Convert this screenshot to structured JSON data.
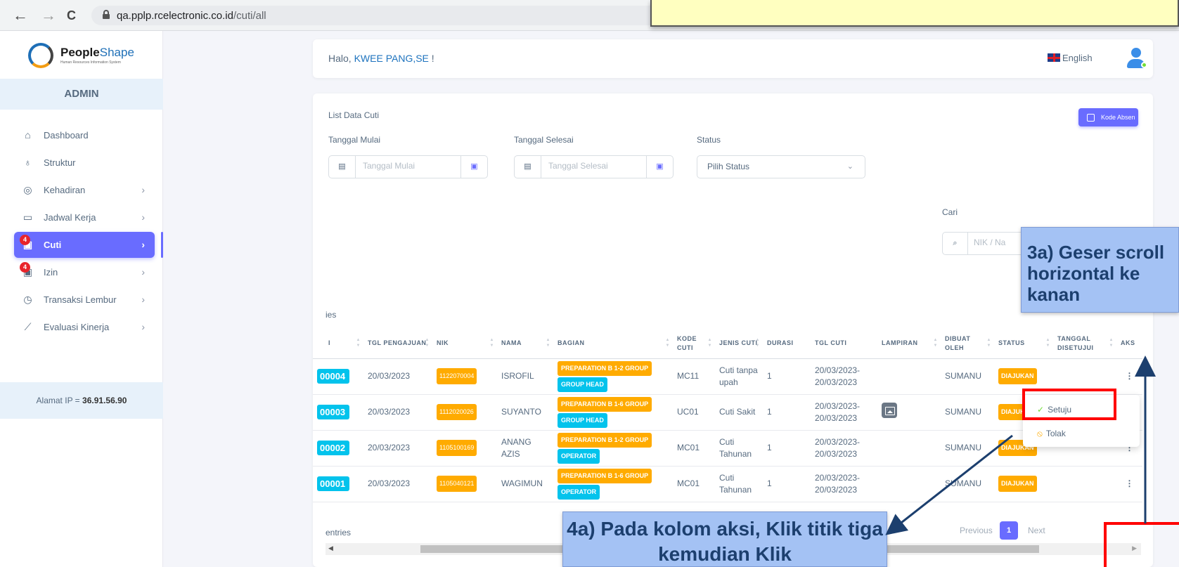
{
  "browser": {
    "back": "←",
    "forward": "→",
    "reload": "C",
    "url_domain": "qa.pplp.rcelectronic.co.id",
    "url_path": "/cuti/all"
  },
  "sidebar": {
    "logo_name_a": "People",
    "logo_name_b": "Shape",
    "logo_tagline": "Human Resources Information System",
    "role": "ADMIN",
    "items": [
      {
        "label": "Dashboard",
        "icon": "home-icon"
      },
      {
        "label": "Struktur",
        "icon": "hierarchy-icon"
      },
      {
        "label": "Kehadiran",
        "icon": "fingerprint-icon"
      },
      {
        "label": "Jadwal Kerja",
        "icon": "briefcase-icon"
      },
      {
        "label": "Cuti",
        "icon": "calendar-icon",
        "badge": "4"
      },
      {
        "label": "Izin",
        "icon": "calendar-icon",
        "badge": "4"
      },
      {
        "label": "Transaksi Lembur",
        "icon": "clock-icon"
      },
      {
        "label": "Evaluasi Kinerja",
        "icon": "chart-line-icon"
      }
    ],
    "ip_label": "Alamat IP  =",
    "ip_value": "36.91.56.90"
  },
  "header": {
    "greeting_prefix": "Halo, ",
    "user": "KWEE PANG,SE",
    "greeting_suffix": " !",
    "language": "English"
  },
  "card": {
    "title": "List Data Cuti",
    "kode_absen": "Kode Absen",
    "tanggal_mulai_label": "Tanggal Mulai",
    "tanggal_mulai_placeholder": "Tanggal Mulai",
    "tanggal_selesai_label": "Tanggal Selesai",
    "tanggal_selesai_placeholder": "Tanggal Selesai",
    "status_label": "Status",
    "status_value": "Pilih Status",
    "cari_label": "Cari",
    "cari_placeholder": "NIK / Na",
    "entries_top": "ies",
    "entries_bottom": "entries"
  },
  "table": {
    "columns": [
      "I",
      "TGL PENGAJUAN",
      "NIK",
      "NAMA",
      "BAGIAN",
      "KODE CUTI",
      "JENIS CUTI",
      "DURASI",
      "TGL CUTI",
      "LAMPIRAN",
      "DIBUAT OLEH",
      "STATUS",
      "TANGGAL DISETUJUI",
      "AKS"
    ],
    "rows": [
      {
        "id": "00004",
        "tgl": "20/03/2023",
        "nik": "1122070004",
        "nama": "ISROFIL",
        "bagian1": "PREPARATION B 1-2 GROUP",
        "bagian2": "GROUP HEAD",
        "kode": "MC11",
        "jenis": "Cuti tanpa upah",
        "durasi": "1",
        "tgl_cuti_a": "20/03/2023-",
        "tgl_cuti_b": "20/03/2023",
        "lampiran": false,
        "oleh": "SUMANU",
        "status": "DIAJUKAN"
      },
      {
        "id": "00003",
        "tgl": "20/03/2023",
        "nik": "1112020026",
        "nama": "SUYANTO",
        "bagian1": "PREPARATION B 1-6 GROUP",
        "bagian2": "GROUP HEAD",
        "kode": "UC01",
        "jenis": "Cuti Sakit",
        "durasi": "1",
        "tgl_cuti_a": "20/03/2023-",
        "tgl_cuti_b": "20/03/2023",
        "lampiran": true,
        "oleh": "SUMANU",
        "status": "DIAJUKAN"
      },
      {
        "id": "00002",
        "tgl": "20/03/2023",
        "nik": "1105100169",
        "nama": "ANANG AZIS",
        "bagian1": "PREPARATION B 1-2 GROUP",
        "bagian2": "OPERATOR",
        "kode": "MC01",
        "jenis": "Cuti Tahunan",
        "durasi": "1",
        "tgl_cuti_a": "20/03/2023-",
        "tgl_cuti_b": "20/03/2023",
        "lampiran": false,
        "oleh": "SUMANU",
        "status": "DIAJUKAN"
      },
      {
        "id": "00001",
        "tgl": "20/03/2023",
        "nik": "1105040121",
        "nama": "WAGIMUN",
        "bagian1": "PREPARATION B 1-6 GROUP",
        "bagian2": "OPERATOR",
        "kode": "MC01",
        "jenis": "Cuti Tahunan",
        "durasi": "1",
        "tgl_cuti_a": "20/03/2023-",
        "tgl_cuti_b": "20/03/2023",
        "lampiran": false,
        "oleh": "SUMANU",
        "status": "DIAJUKAN"
      }
    ]
  },
  "pagination": {
    "previous": "Previous",
    "page": "1",
    "next": "Next"
  },
  "dropdown": {
    "setuju": "Setuju",
    "tolak": "Tolak"
  },
  "annotations": {
    "callout_3a": "3a) Geser scroll horizontal ke kanan",
    "callout_4a": "4a) Pada kolom aksi, Klik titik tiga kemudian Klik"
  }
}
